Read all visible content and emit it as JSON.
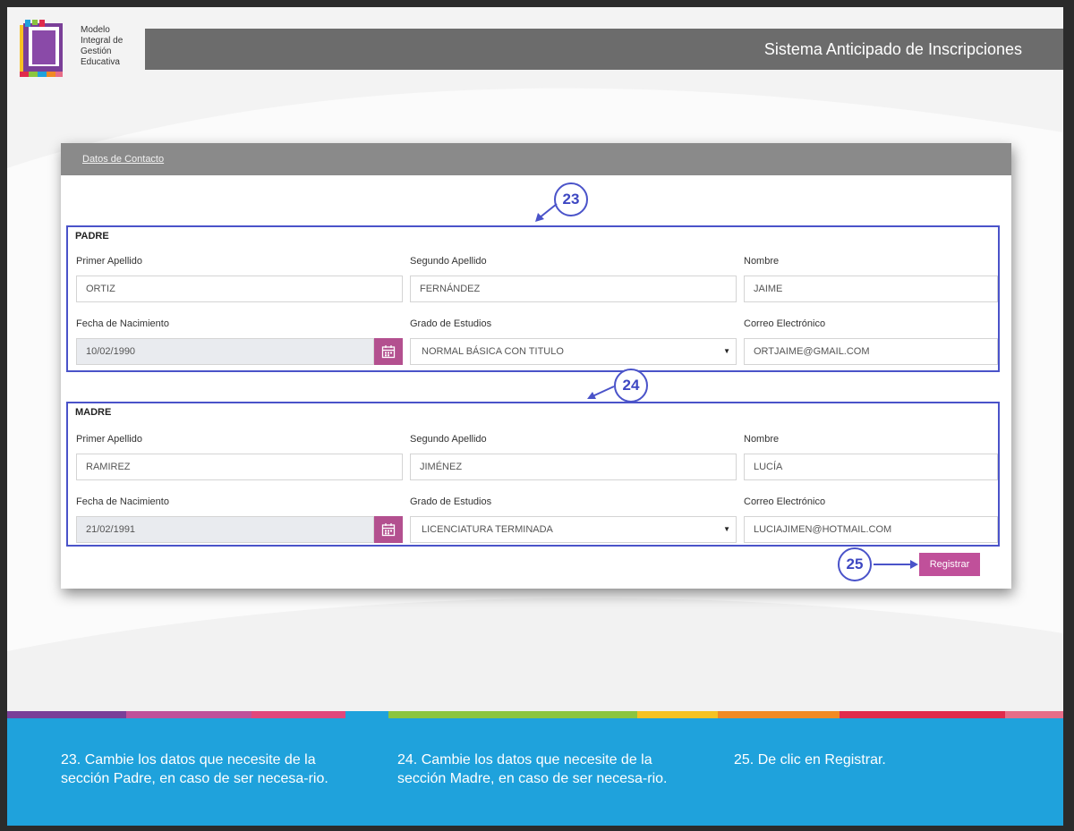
{
  "logo": {
    "lines": [
      "Modelo",
      "Integral de",
      "Gestión",
      "Educativa"
    ]
  },
  "header": {
    "title": "Sistema Anticipado de Inscripciones"
  },
  "card": {
    "tab_label": "Datos de Contacto",
    "padre": {
      "title": "PADRE",
      "primer_apellido": {
        "label": "Primer Apellido",
        "value": "ORTIZ"
      },
      "segundo_apellido": {
        "label": "Segundo Apellido",
        "value": "FERNÁNDEZ"
      },
      "nombre": {
        "label": "Nombre",
        "value": "JAIME"
      },
      "fecha_nacimiento": {
        "label": "Fecha de Nacimiento",
        "value": "10/02/1990"
      },
      "grado_estudios": {
        "label": "Grado de Estudios",
        "value": "NORMAL BÁSICA CON TITULO"
      },
      "correo": {
        "label": "Correo Electrónico",
        "value": "ORTJAIME@GMAIL.COM"
      }
    },
    "madre": {
      "title": "MADRE",
      "primer_apellido": {
        "label": "Primer Apellido",
        "value": "RAMIREZ"
      },
      "segundo_apellido": {
        "label": "Segundo Apellido",
        "value": "JIMÉNEZ"
      },
      "nombre": {
        "label": "Nombre",
        "value": "LUCÍA"
      },
      "fecha_nacimiento": {
        "label": "Fecha de Nacimiento",
        "value": "21/02/1991"
      },
      "grado_estudios": {
        "label": "Grado de Estudios",
        "value": "LICENCIATURA TERMINADA"
      },
      "correo": {
        "label": "Correo Electrónico",
        "value": "LUCIAJIMEN@HOTMAIL.COM"
      }
    },
    "register_label": "Registrar"
  },
  "callouts": {
    "c23": "23",
    "c24": "24",
    "c25": "25"
  },
  "instructions": {
    "step23": "23. Cambie los datos que necesite de la sección Padre, en caso de ser necesa-rio.",
    "step24": "24. Cambie los datos que necesite de la sección Madre, en caso de ser necesa-rio.",
    "step25": "25. De clic en Registrar."
  },
  "colors": {
    "accent": "#4a53c9",
    "button": "#c0509a",
    "calendar": "#b3508f",
    "footer": "#1fa2dc",
    "header_bar": "#6c6c6c",
    "stripes": [
      "#7a3f98",
      "#c0509a",
      "#e1467c",
      "#1fa2dc",
      "#8bc53f",
      "#f6c223",
      "#f08a24",
      "#e02b4c",
      "#e76d88"
    ]
  },
  "icons": {
    "calendar": "calendar-icon",
    "dropdown": "chevron-down-icon",
    "logo": "book-logo-icon"
  }
}
